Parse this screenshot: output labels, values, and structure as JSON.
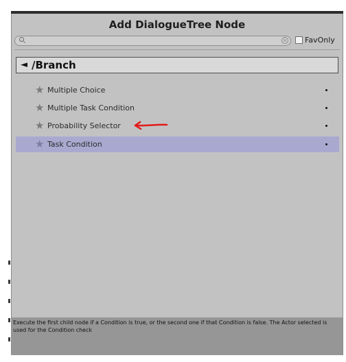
{
  "window": {
    "title": "Add DialogueTree Node"
  },
  "search": {
    "value": "",
    "placeholder": "",
    "fav_only_label": "FavOnly"
  },
  "category": {
    "arrow": "◄",
    "label": "/Branch"
  },
  "items": [
    {
      "label": "Multiple Choice",
      "icon": "star-icon",
      "selected": false
    },
    {
      "label": "Multiple Task Condition",
      "icon": "star-icon",
      "selected": false
    },
    {
      "label": "Probability Selector",
      "icon": "star-icon",
      "selected": false
    },
    {
      "label": "Task Condition",
      "icon": "star-icon",
      "selected": true
    }
  ],
  "footer": {
    "description": "Execute the first child node if a Condition is true, or the second one if that Condition is false. The Actor selected is used for the Condition check"
  },
  "colors": {
    "window_bg": "#c2c2c2",
    "selected_row": "#a9a9d0",
    "footer_bg": "#969696",
    "annotation_arrow": "#e31a1a"
  }
}
